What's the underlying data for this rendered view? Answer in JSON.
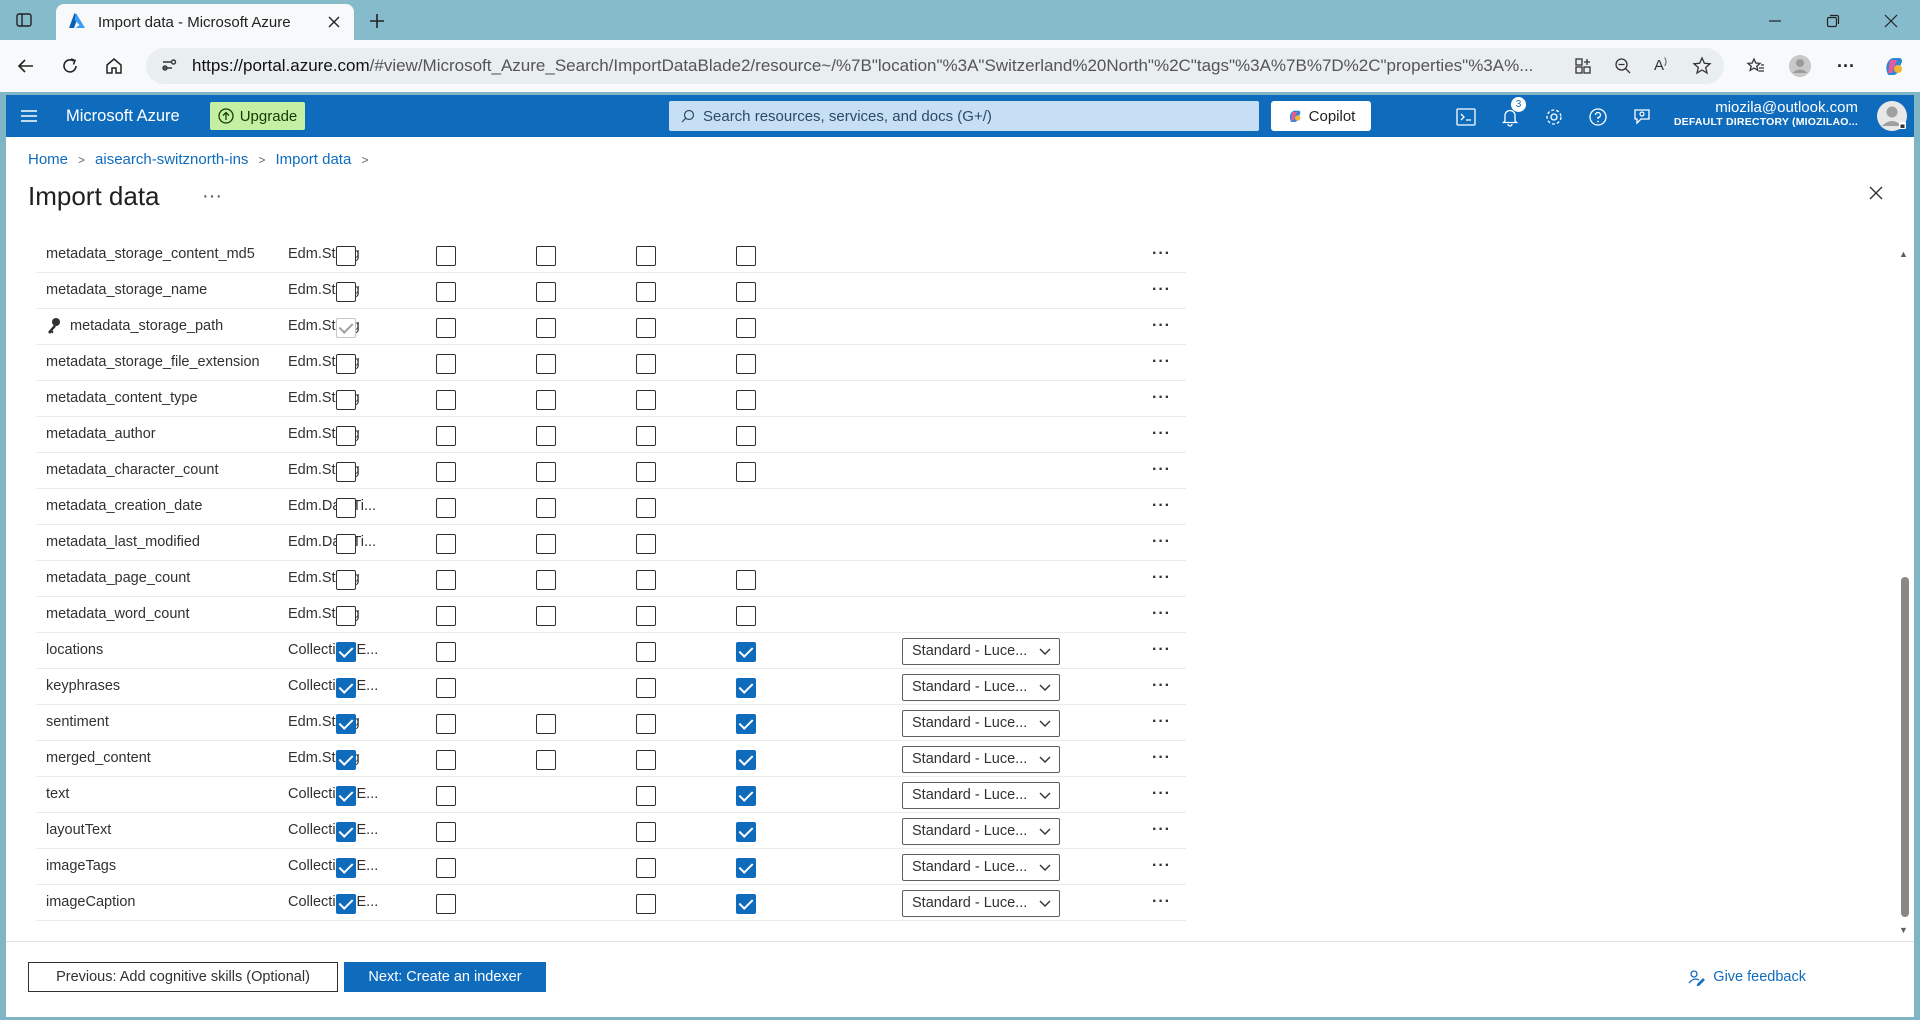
{
  "browser": {
    "tab_title": "Import data - Microsoft Azure",
    "url_host": "https://portal.azure.com",
    "url_path": "/#view/Microsoft_Azure_Search/ImportDataBlade2/resource~/%7B\"location\"%3A\"Switzerland%20North\"%2C\"tags\"%3A%7B%7D%2C\"properties\"%3A%..."
  },
  "header": {
    "brand": "Microsoft Azure",
    "upgrade_label": "Upgrade",
    "search_placeholder": "Search resources, services, and docs (G+/)",
    "copilot_label": "Copilot",
    "notification_count": "3",
    "account_email": "miozila@outlook.com",
    "account_directory": "DEFAULT DIRECTORY (MIOZILAO..."
  },
  "breadcrumb": [
    "Home",
    "aisearch-switznorth-ins",
    "Import data"
  ],
  "page_title": "Import data",
  "dropdown_value": "Standard - Luce...",
  "fields": [
    {
      "name": "metadata_storage_content_md5",
      "type": "Edm.String",
      "checks": [
        0,
        0,
        0,
        0,
        0
      ],
      "analyzer": false,
      "key": false
    },
    {
      "name": "metadata_storage_name",
      "type": "Edm.String",
      "checks": [
        0,
        0,
        0,
        0,
        0
      ],
      "analyzer": false,
      "key": false
    },
    {
      "name": "metadata_storage_path",
      "type": "Edm.String",
      "checks": [
        2,
        0,
        0,
        0,
        0
      ],
      "analyzer": false,
      "key": true
    },
    {
      "name": "metadata_storage_file_extension",
      "type": "Edm.String",
      "checks": [
        0,
        0,
        0,
        0,
        0
      ],
      "analyzer": false,
      "key": false
    },
    {
      "name": "metadata_content_type",
      "type": "Edm.String",
      "checks": [
        0,
        0,
        0,
        0,
        0
      ],
      "analyzer": false,
      "key": false
    },
    {
      "name": "metadata_author",
      "type": "Edm.String",
      "checks": [
        0,
        0,
        0,
        0,
        0
      ],
      "analyzer": false,
      "key": false
    },
    {
      "name": "metadata_character_count",
      "type": "Edm.String",
      "checks": [
        0,
        0,
        0,
        0,
        0
      ],
      "analyzer": false,
      "key": false
    },
    {
      "name": "metadata_creation_date",
      "type": "Edm.DateTi...",
      "checks": [
        0,
        0,
        0,
        0,
        -1
      ],
      "analyzer": false,
      "key": false
    },
    {
      "name": "metadata_last_modified",
      "type": "Edm.DateTi...",
      "checks": [
        0,
        0,
        0,
        0,
        -1
      ],
      "analyzer": false,
      "key": false
    },
    {
      "name": "metadata_page_count",
      "type": "Edm.String",
      "checks": [
        0,
        0,
        0,
        0,
        0
      ],
      "analyzer": false,
      "key": false
    },
    {
      "name": "metadata_word_count",
      "type": "Edm.String",
      "checks": [
        0,
        0,
        0,
        0,
        0
      ],
      "analyzer": false,
      "key": false
    },
    {
      "name": "locations",
      "type": "Collection(E...",
      "checks": [
        1,
        0,
        -1,
        0,
        1
      ],
      "analyzer": true,
      "key": false
    },
    {
      "name": "keyphrases",
      "type": "Collection(E...",
      "checks": [
        1,
        0,
        -1,
        0,
        1
      ],
      "analyzer": true,
      "key": false
    },
    {
      "name": "sentiment",
      "type": "Edm.String",
      "checks": [
        1,
        0,
        0,
        0,
        1
      ],
      "analyzer": true,
      "key": false
    },
    {
      "name": "merged_content",
      "type": "Edm.String",
      "checks": [
        1,
        0,
        0,
        0,
        1
      ],
      "analyzer": true,
      "key": false
    },
    {
      "name": "text",
      "type": "Collection(E...",
      "checks": [
        1,
        0,
        -1,
        0,
        1
      ],
      "analyzer": true,
      "key": false
    },
    {
      "name": "layoutText",
      "type": "Collection(E...",
      "checks": [
        1,
        0,
        -1,
        0,
        1
      ],
      "analyzer": true,
      "key": false
    },
    {
      "name": "imageTags",
      "type": "Collection(E...",
      "checks": [
        1,
        0,
        -1,
        0,
        1
      ],
      "analyzer": true,
      "key": false
    },
    {
      "name": "imageCaption",
      "type": "Collection(E...",
      "checks": [
        1,
        0,
        -1,
        0,
        1
      ],
      "analyzer": true,
      "key": false
    }
  ],
  "footer": {
    "prev_label": "Previous: Add cognitive skills (Optional)",
    "next_label": "Next: Create an indexer",
    "feedback_label": "Give feedback"
  },
  "colors": {
    "accent": "#0f6cbd",
    "upgrade": "#c5f0a4",
    "chrome": "#86bbcb"
  }
}
